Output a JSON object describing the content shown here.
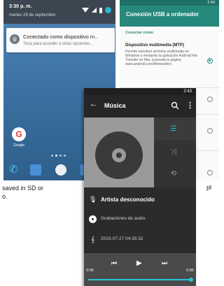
{
  "notification_phone": {
    "time": "3:30 p. m.",
    "date": "martes 29 de septiembre",
    "notification": {
      "title": "Conectado como dispositivo m..",
      "subtitle": "Toca para acceder a otras opciones.."
    },
    "app_label": "Google"
  },
  "usb_phone": {
    "status_time": "2:43",
    "title": "Conexión USB a ordenador",
    "section": "Conectar como",
    "option_title": "Dispositivo multimedia (MTP)",
    "option_description": "Permitir transferir archivos multimedia en Windows o mediante la aplicación Android File Transfer en Mac (consulta la página www.android.com/filetransfer)",
    "accent_color": "#26897b"
  },
  "music_phone": {
    "status_time": "2:43",
    "title": "Música",
    "artist": "Artista desconocido",
    "album": "Grabaciones de audio",
    "date": "2015-07-27 04:35:32",
    "elapsed": "0:05",
    "duration": "0:05",
    "progress": 1.0,
    "accent_color": "#26c6da"
  },
  "document": {
    "line1_left": "saved in SD or",
    "line2_left": "o.",
    "line1_right": "pl"
  }
}
